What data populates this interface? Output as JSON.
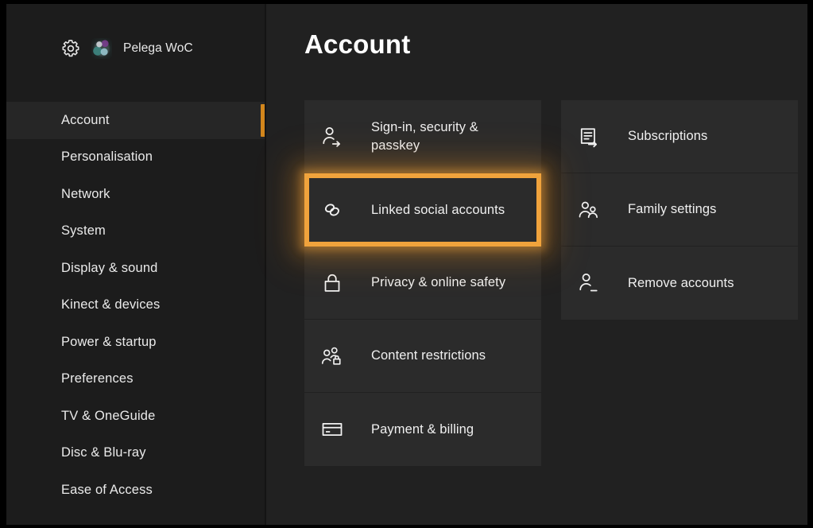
{
  "profile": {
    "gear_icon": "gear-icon",
    "avatar_icon": "avatar",
    "gamertag": "Pelega WoC"
  },
  "header": {
    "title": "Account"
  },
  "sidebar": {
    "selected": "Account",
    "accent_color": "#d2861c",
    "items": [
      {
        "label": "Account",
        "selected": true
      },
      {
        "label": "Personalisation",
        "selected": false
      },
      {
        "label": "Network",
        "selected": false
      },
      {
        "label": "System",
        "selected": false
      },
      {
        "label": "Display & sound",
        "selected": false
      },
      {
        "label": "Kinect & devices",
        "selected": false
      },
      {
        "label": "Power & startup",
        "selected": false
      },
      {
        "label": "Preferences",
        "selected": false
      },
      {
        "label": "TV & OneGuide",
        "selected": false
      },
      {
        "label": "Disc & Blu-ray",
        "selected": false
      },
      {
        "label": "Ease of Access",
        "selected": false
      }
    ]
  },
  "main": {
    "focus_color": "#f0a33c",
    "left_column": [
      {
        "label": "Sign-in, security & passkey",
        "icon": "person-arrow-icon",
        "focused": false
      },
      {
        "label": "Linked social accounts",
        "icon": "link-icon",
        "focused": true
      },
      {
        "label": "Privacy & online safety",
        "icon": "lock-icon",
        "focused": false
      },
      {
        "label": "Content restrictions",
        "icon": "people-lock-icon",
        "focused": false
      },
      {
        "label": "Payment & billing",
        "icon": "credit-card-icon",
        "focused": false
      }
    ],
    "right_column": [
      {
        "label": "Subscriptions",
        "icon": "document-arrow-icon",
        "focused": false
      },
      {
        "label": "Family settings",
        "icon": "people-icon",
        "focused": false
      },
      {
        "label": "Remove accounts",
        "icon": "person-minus-icon",
        "focused": false
      }
    ]
  }
}
